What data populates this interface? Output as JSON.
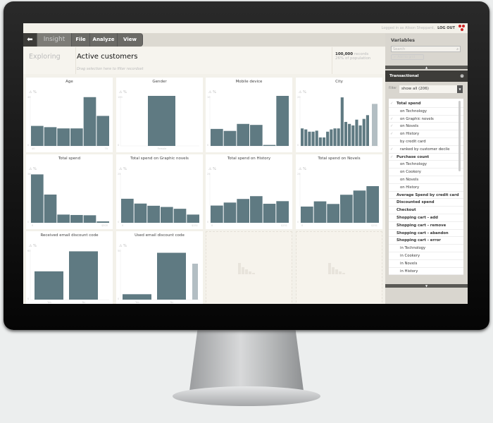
{
  "topbar": {
    "logged_in": "Logged in as Alison Sheppard,",
    "logout": "LOG OUT"
  },
  "toolbar": {
    "back_icon": "arrow-left-icon",
    "app_name": "Insight",
    "menus": [
      "File",
      "Analyze",
      "View"
    ]
  },
  "header": {
    "exploring": "Exploring",
    "title": "Active customers",
    "drop_hint": "Drag selection here to filter recordset",
    "records_count": "100,000",
    "records_label": "records",
    "population": "26% of population"
  },
  "variables": {
    "title": "Variables",
    "search_placeholder": "Search",
    "add_to_grid": "Add to grid",
    "section": "Transactional",
    "filter_label": "Filter",
    "filter_value": "show all (206)",
    "items": [
      {
        "label": "Total spend",
        "bold": true,
        "checked": true
      },
      {
        "label": "on Technology",
        "bold": false,
        "checked": false
      },
      {
        "label": "on Graphic novels",
        "bold": false,
        "checked": true
      },
      {
        "label": "on Novels",
        "bold": false,
        "checked": true
      },
      {
        "label": "on History",
        "bold": false,
        "checked": true
      },
      {
        "label": "by credit card",
        "bold": false,
        "checked": false
      },
      {
        "label": "ranked by customer decile",
        "bold": false,
        "checked": true
      },
      {
        "label": "Purchase count",
        "bold": true,
        "checked": true
      },
      {
        "label": "on Technology",
        "bold": false,
        "checked": false
      },
      {
        "label": "on Cookery",
        "bold": false,
        "checked": false
      },
      {
        "label": "on Novels",
        "bold": false,
        "checked": false
      },
      {
        "label": "on History",
        "bold": false,
        "checked": false
      },
      {
        "label": "Average Spend by credit card",
        "bold": true,
        "checked": false
      },
      {
        "label": "Discounted spend",
        "bold": true,
        "checked": false
      },
      {
        "label": "Checkout",
        "bold": true,
        "checked": false
      },
      {
        "label": "Shopping cart - add",
        "bold": true,
        "checked": false
      },
      {
        "label": "Shopping cart - remove",
        "bold": true,
        "checked": false
      },
      {
        "label": "Shopping cart - abandon",
        "bold": true,
        "checked": false
      },
      {
        "label": "Shopping cart - error",
        "bold": true,
        "checked": false
      },
      {
        "label": "in Technology",
        "bold": false,
        "checked": false
      },
      {
        "label": "in Cookery",
        "bold": false,
        "checked": false
      },
      {
        "label": "in Novels",
        "bold": false,
        "checked": false
      },
      {
        "label": "in History",
        "bold": false,
        "checked": false
      }
    ]
  },
  "colors": {
    "bar": "#5f7a82",
    "highlight": "#b3bec3",
    "panel_dark": "#3d3c39"
  },
  "chart_data": [
    {
      "type": "bar",
      "title": "Age",
      "unit": "%",
      "ymax": "40",
      "ylim": [
        0,
        40
      ],
      "xlabels": [
        "40",
        "70"
      ],
      "values": [
        16,
        15,
        14,
        14,
        39,
        24
      ]
    },
    {
      "type": "bar",
      "title": "Gender",
      "unit": "%",
      "ymax": "100",
      "ylim": [
        0,
        100
      ],
      "xlabels": [
        "Female"
      ],
      "values": [
        100
      ],
      "single": true
    },
    {
      "type": "bar",
      "title": "Mobile device",
      "unit": "%",
      "ymax": "10",
      "ylim": [
        0,
        10
      ],
      "xlabels": [],
      "values": [
        3.4,
        3.0,
        4.4,
        4.2,
        0.2,
        10
      ]
    },
    {
      "type": "bar",
      "title": "City",
      "unit": "%",
      "ymax": "20",
      "ylim": [
        0,
        20
      ],
      "xlabels": [],
      "values": [
        7,
        6.6,
        5.7,
        5.7,
        6.1,
        3.4,
        3.4,
        5.7,
        6.6,
        7,
        7,
        19.4,
        9.6,
        8.8,
        8.2,
        10.5,
        8.2,
        10.8,
        12.3
      ],
      "highlight": 16.8
    },
    {
      "type": "bar",
      "title": "Total spend",
      "unit": "%",
      "ymax": "36",
      "ylim": [
        0,
        36
      ],
      "xlabels": [
        "0",
        "$500"
      ],
      "values": [
        34.8,
        20.3,
        5.9,
        5.6,
        5.4,
        1.0
      ]
    },
    {
      "type": "bar",
      "title": "Total spend on Graphic novels",
      "unit": "%",
      "ymax": "25",
      "ylim": [
        0,
        25
      ],
      "xlabels": [
        "0",
        "$151"
      ],
      "values": [
        12,
        9.6,
        8.5,
        7.9,
        7,
        4.1
      ]
    },
    {
      "type": "bar",
      "title": "Total spend on History",
      "unit": "%",
      "ymax": "25",
      "ylim": [
        0,
        25
      ],
      "xlabels": [
        "0",
        "$151"
      ],
      "values": [
        8.6,
        10.1,
        11.9,
        13.3,
        9.5,
        10.8
      ]
    },
    {
      "type": "bar",
      "title": "Total spend on Novels",
      "unit": "%",
      "ymax": "25",
      "ylim": [
        0,
        25
      ],
      "xlabels": [
        "0",
        "$151"
      ],
      "values": [
        8.1,
        10.7,
        9.4,
        14,
        16.1,
        18.3
      ]
    },
    {
      "type": "bar",
      "title": "Received email discount code",
      "unit": "%",
      "ymax": "60",
      "ylim": [
        0,
        60
      ],
      "xlabels": [
        "Yes",
        "No"
      ],
      "values": [
        33.9,
        57.9
      ]
    },
    {
      "type": "bar",
      "title": "Used email discount code",
      "unit": "%",
      "ymax": "50",
      "ylim": [
        0,
        50
      ],
      "xlabels": [
        "Yes",
        "No"
      ],
      "values": [
        5.4,
        46.8
      ],
      "highlight": 35.9
    }
  ]
}
